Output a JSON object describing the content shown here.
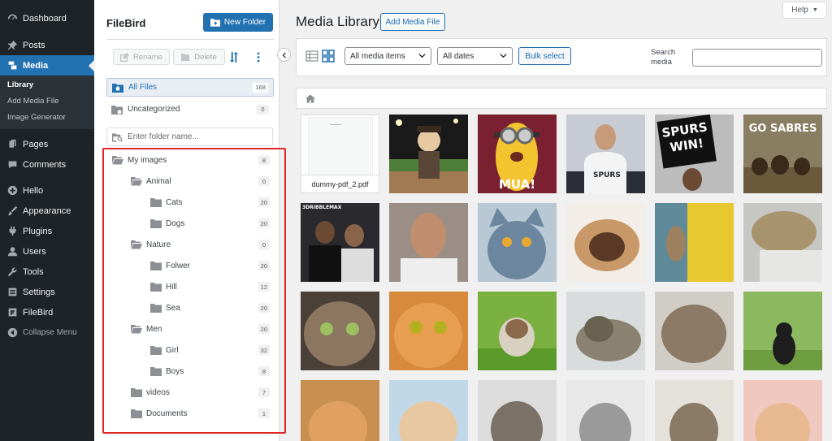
{
  "wp_menu": {
    "dashboard": "Dashboard",
    "posts": "Posts",
    "media": "Media",
    "media_sub": [
      "Library",
      "Add Media File",
      "Image Generator"
    ],
    "pages": "Pages",
    "comments": "Comments",
    "hello": "Hello",
    "appearance": "Appearance",
    "plugins": "Plugins",
    "users": "Users",
    "tools": "Tools",
    "settings": "Settings",
    "filebird": "FileBird",
    "collapse": "Collapse Menu"
  },
  "filebird": {
    "title": "FileBird",
    "new_folder": "New Folder",
    "rename": "Rename",
    "delete": "Delete",
    "all_files": {
      "label": "All Files",
      "count": "168"
    },
    "uncategorized": {
      "label": "Uncategorized",
      "count": "0"
    },
    "search_placeholder": "Enter folder name...",
    "tree": [
      {
        "label": "My images",
        "count": "8"
      },
      {
        "label": "Animal",
        "count": "0"
      },
      {
        "label": "Cats",
        "count": "20"
      },
      {
        "label": "Dogs",
        "count": "20"
      },
      {
        "label": "Nature",
        "count": "0"
      },
      {
        "label": "Folwer",
        "count": "20"
      },
      {
        "label": "Hill",
        "count": "12"
      },
      {
        "label": "Sea",
        "count": "20"
      },
      {
        "label": "Men",
        "count": "20"
      },
      {
        "label": "Girl",
        "count": "32"
      },
      {
        "label": "Boys",
        "count": "8"
      },
      {
        "label": "videos",
        "count": "7"
      },
      {
        "label": "Documents",
        "count": "1"
      }
    ]
  },
  "media": {
    "title": "Media Library",
    "add_media": "Add Media File",
    "help": "Help",
    "filter_type": "All media items",
    "filter_date": "All dates",
    "bulk_select": "Bulk select",
    "search_label": "Search media",
    "pdf_name": "dummy-pdf_2.pdf",
    "captions": {
      "minion": "MUA!",
      "spurs_line1": "SPURS",
      "spurs_line2": "WIN!",
      "sabres": "GO SABRES",
      "jersey": "SPURS",
      "tag": "3DRIBBLEMAX"
    }
  },
  "colors": {
    "sidebar_bg": "#1d2327",
    "accent": "#2271b1",
    "highlight_border": "#e02525"
  }
}
